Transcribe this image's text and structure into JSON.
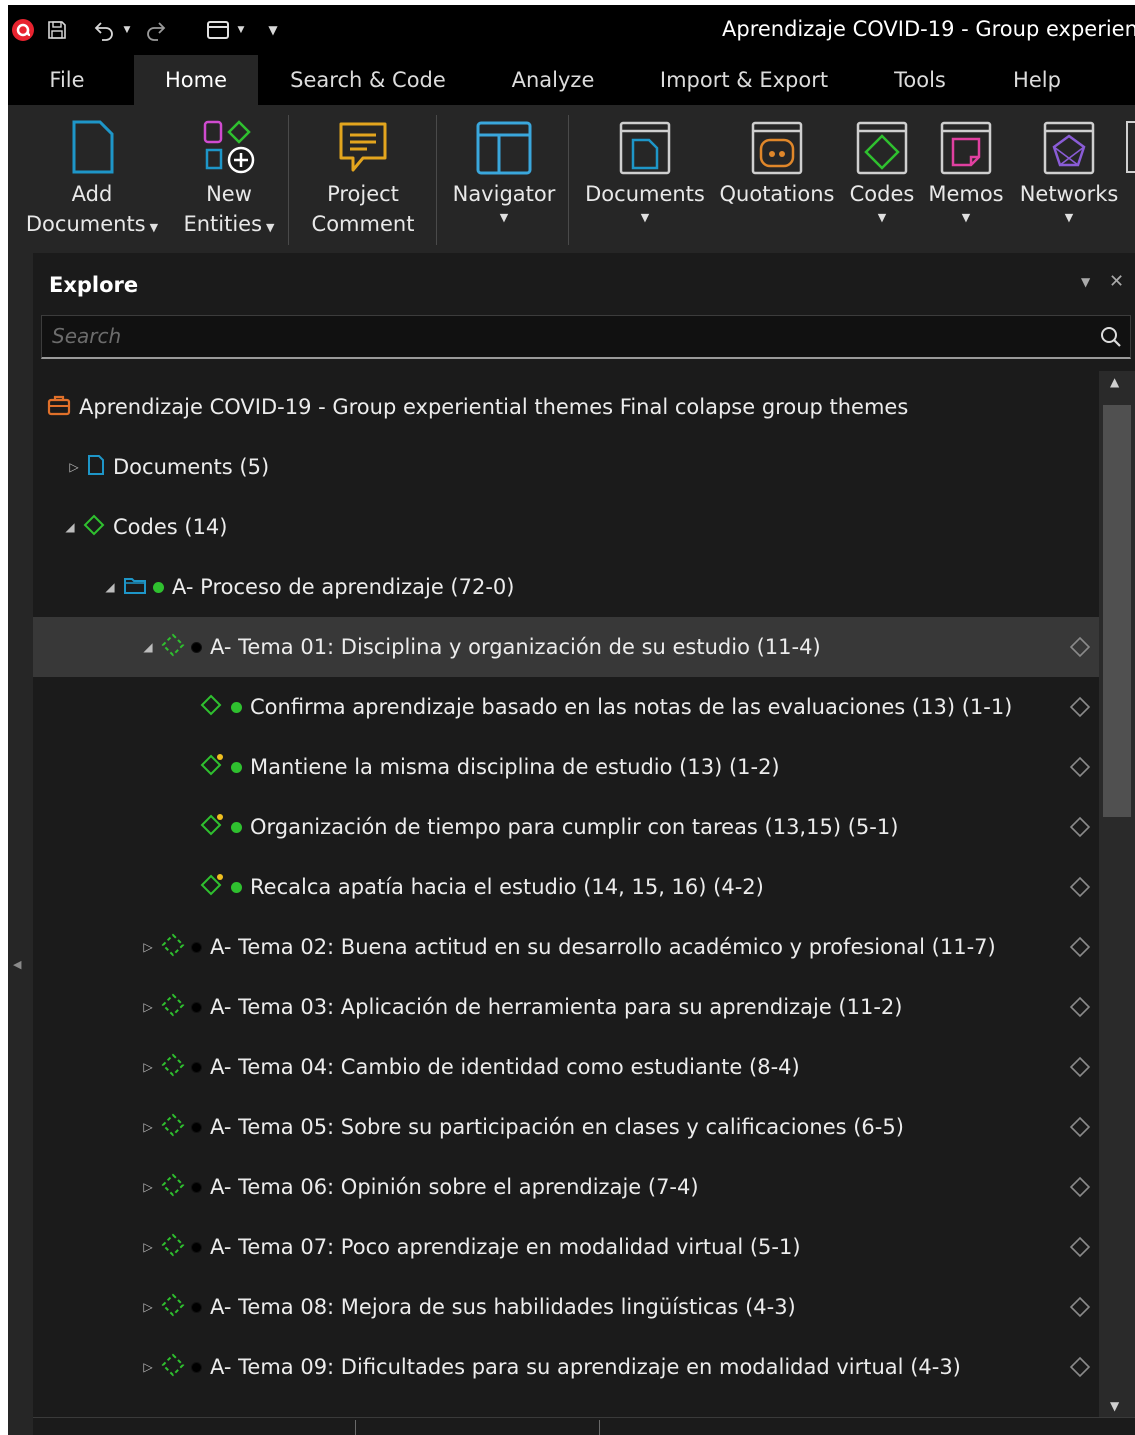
{
  "window": {
    "title": "Aprendizaje COVID-19 - Group experien"
  },
  "menu": {
    "tabs": [
      "File",
      "Home",
      "Search & Code",
      "Analyze",
      "Import & Export",
      "Tools",
      "Help"
    ],
    "active": "Home"
  },
  "ribbon": {
    "add_documents": [
      "Add",
      "Documents"
    ],
    "new_entities": [
      "New",
      "Entities"
    ],
    "project_comment": [
      "Project",
      "Comment"
    ],
    "navigator": "Navigator",
    "documents": "Documents",
    "quotations": "Quotations",
    "codes": "Codes",
    "memos": "Memos",
    "networks": "Networks"
  },
  "explore": {
    "title": "Explore",
    "search_placeholder": "Search",
    "project": "Aprendizaje COVID-19 - Group experiential themes Final colapse group themes",
    "documents": "Documents (5)",
    "codes": "Codes (14)",
    "group": "A- Proceso de aprendizaje (72-0)",
    "rows": [
      {
        "label": "A- Tema 01: Disciplina y organización de su estudio (11-4)",
        "expanded": true,
        "selected": true
      },
      {
        "label": "Confirma aprendizaje basado en las notas de las evaluaciones (13) (1-1)",
        "memo": false
      },
      {
        "label": "Mantiene la misma disciplina de estudio (13) (1-2)",
        "memo": true
      },
      {
        "label": "Organización de tiempo para cumplir con tareas (13,15) (5-1)",
        "memo": true
      },
      {
        "label": "Recalca apatía hacia el estudio (14, 15, 16) (4-2)",
        "memo": true
      },
      {
        "label": "A- Tema 02: Buena actitud en su desarrollo académico y profesional (11-7)"
      },
      {
        "label": "A- Tema 03: Aplicación de herramienta para su aprendizaje (11-2)"
      },
      {
        "label": "A- Tema 04: Cambio de identidad como estudiante (8-4)"
      },
      {
        "label": "A- Tema 05: Sobre su participación en clases y calificaciones (6-5)"
      },
      {
        "label": "A- Tema 06: Opinión sobre el aprendizaje (7-4)"
      },
      {
        "label": "A- Tema 07: Poco aprendizaje en modalidad virtual (5-1)"
      },
      {
        "label": "A- Tema 08: Mejora de sus habilidades lingüísticas (4-3)"
      },
      {
        "label": "A- Tema 09: Dificultades para su aprendizaje en modalidad virtual (4-3)"
      }
    ]
  },
  "colors": {
    "background": "#1b1b1b",
    "ribbon": "#262626",
    "accent_red": "#e8232f",
    "code_green": "#2fc02f",
    "doc_blue": "#1e96c8",
    "memo_pink": "#e040a0",
    "network_purple": "#8a5cd6",
    "quotation_orange": "#e0872a"
  }
}
